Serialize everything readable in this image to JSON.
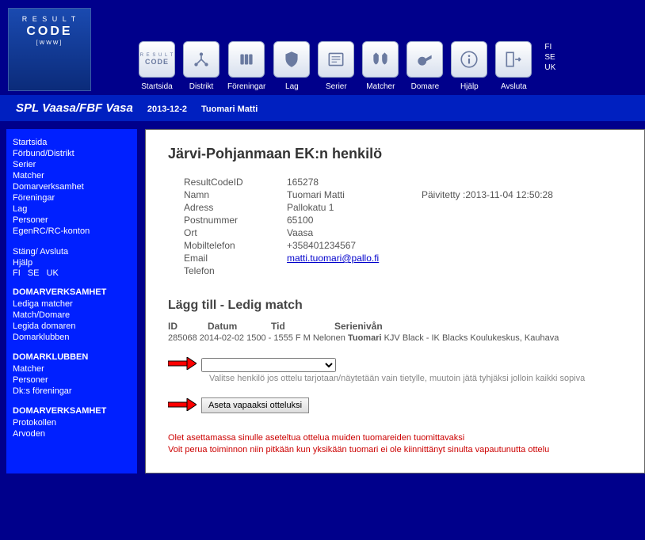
{
  "logo": {
    "line1": "R E S U L T",
    "line2": "CODE",
    "line3": "[WWW]"
  },
  "toolbar": {
    "startsida": "Startsida",
    "distrikt": "Distrikt",
    "foreningar": "Föreningar",
    "lag": "Lag",
    "serier": "Serier",
    "matcher": "Matcher",
    "domare": "Domare",
    "hjalp": "Hjälp",
    "avsluta": "Avsluta"
  },
  "langs": {
    "fi": "FI",
    "se": "SE",
    "uk": "UK"
  },
  "breadcrumb": {
    "org": "SPL Vaasa/FBF Vasa",
    "date": "2013-12-2",
    "user": "Tuomari Matti"
  },
  "sidebar": {
    "group1": {
      "startsida": "Startsida",
      "forbund": "Förbund/Distrikt",
      "serier": "Serier",
      "matcher": "Matcher",
      "domarverksamhet": "Domarverksamhet",
      "foreningar": "Föreningar",
      "lag": "Lag",
      "personer": "Personer",
      "egenrc": "EgenRC/RC-konton"
    },
    "group2": {
      "stang": "Stäng/ Avsluta",
      "hjalp": "Hjälp"
    },
    "langline": {
      "fi": "FI",
      "se": "SE",
      "uk": "UK"
    },
    "sec_domarverksamhet": {
      "hdr": "DOMARVERKSAMHET",
      "lediga": "Lediga matcher",
      "matchdomare": "Match/Domare",
      "legida": "Legida domaren",
      "domarklubben": "Domarklubben"
    },
    "sec_domarklubben": {
      "hdr": "DOMARKLUBBEN",
      "matcher": "Matcher",
      "personer": "Personer",
      "dks": "Dk:s föreningar"
    },
    "sec_domarverksamhet2": {
      "hdr": "DOMARVERKSAMHET",
      "protokollen": "Protokollen",
      "arvoden": "Arvoden"
    }
  },
  "page": {
    "title": "Järvi-Pohjanmaan EK:n henkilö",
    "labels": {
      "id": "ResultCodeID",
      "namn": "Namn",
      "adress": "Adress",
      "post": "Postnummer",
      "ort": "Ort",
      "mobil": "Mobiltelefon",
      "email": "Email",
      "tel": "Telefon",
      "updated": "Päivitetty :"
    },
    "values": {
      "id": "165278",
      "namn": "Tuomari Matti",
      "adress": "Pallokatu 1",
      "post": "65100",
      "ort": "Vaasa",
      "mobil": "+358401234567",
      "email": "matti.tuomari@pallo.fi",
      "updated": "2013-11-04 12:50:28"
    },
    "section2": "Lägg till - Ledig match",
    "match_header": {
      "id": "ID",
      "datum": "Datum",
      "tid": "Tid",
      "snivan": "Serienivån"
    },
    "match_row": {
      "id": "285068",
      "datum": "2014-02-02",
      "tid": "1500 - 1555",
      "lvl": "F M Nelonen",
      "roll": "Tuomari",
      "rest": "KJV Black - IK Blacks Koulukeskus, Kauhava"
    },
    "hint": "Valitse henkilö jos ottelu tarjotaan/näytetään vain tietylle, muutoin jätä tyhjäksi jolloin kaikki sopiva",
    "button": "Aseta vapaaksi otteluksi",
    "warn1": "Olet asettamassa sinulle aseteltua ottelua muiden tuomareiden tuomittavaksi",
    "warn2": "Voit perua toiminnon niin pitkään kun yksikään tuomari ei ole kiinnittänyt sinulta vapautunutta ottelu"
  }
}
